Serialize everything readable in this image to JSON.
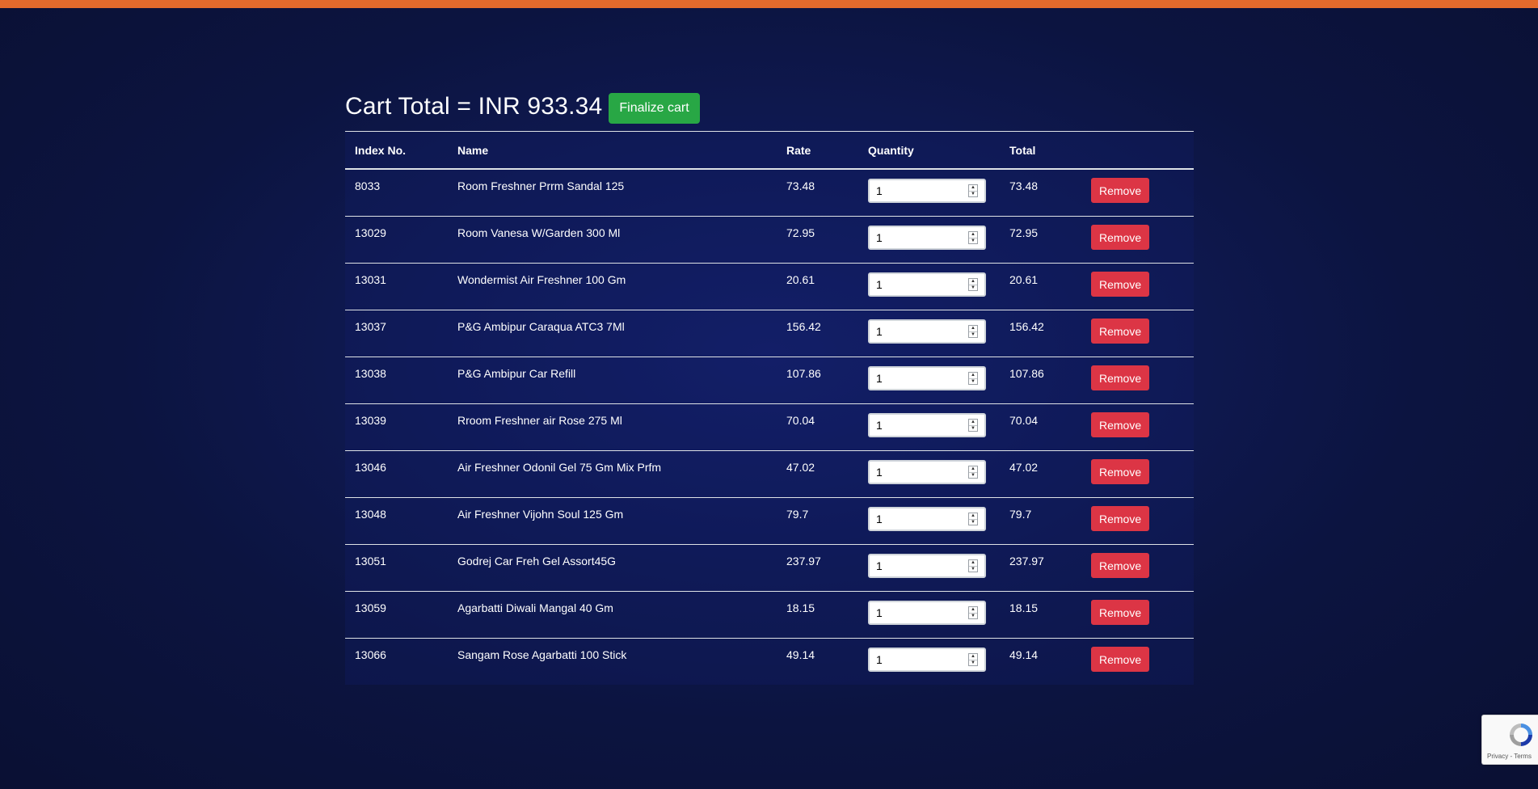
{
  "colors": {
    "top_bar": "#e36a2c",
    "background": "#0c1440",
    "finalize": "#28a745",
    "remove": "#dc3545"
  },
  "cart": {
    "title": "Cart Total = INR 933.34",
    "finalize_label": "Finalize cart"
  },
  "table": {
    "headers": [
      "Index No.",
      "Name",
      "Rate",
      "Quantity",
      "Total",
      ""
    ],
    "remove_label": "Remove",
    "rows": [
      {
        "index": "8033",
        "name": "Room Freshner Prrm Sandal 125",
        "rate": "73.48",
        "qty": "1",
        "total": "73.48"
      },
      {
        "index": "13029",
        "name": "Room Vanesa W/Garden 300 Ml",
        "rate": "72.95",
        "qty": "1",
        "total": "72.95"
      },
      {
        "index": "13031",
        "name": "Wondermist Air Freshner 100 Gm",
        "rate": "20.61",
        "qty": "1",
        "total": "20.61"
      },
      {
        "index": "13037",
        "name": "P&G Ambipur Caraqua ATC3 7Ml",
        "rate": "156.42",
        "qty": "1",
        "total": "156.42"
      },
      {
        "index": "13038",
        "name": "P&G Ambipur Car Refill",
        "rate": "107.86",
        "qty": "1",
        "total": "107.86"
      },
      {
        "index": "13039",
        "name": "Rroom Freshner air Rose 275 Ml",
        "rate": "70.04",
        "qty": "1",
        "total": "70.04"
      },
      {
        "index": "13046",
        "name": "Air Freshner Odonil Gel 75 Gm Mix Prfm",
        "rate": "47.02",
        "qty": "1",
        "total": "47.02"
      },
      {
        "index": "13048",
        "name": "Air Freshner Vijohn Soul 125 Gm",
        "rate": "79.7",
        "qty": "1",
        "total": "79.7"
      },
      {
        "index": "13051",
        "name": "Godrej Car Freh Gel Assort45G",
        "rate": "237.97",
        "qty": "1",
        "total": "237.97"
      },
      {
        "index": "13059",
        "name": "Agarbatti Diwali Mangal 40 Gm",
        "rate": "18.15",
        "qty": "1",
        "total": "18.15"
      },
      {
        "index": "13066",
        "name": "Sangam Rose Agarbatti 100 Stick",
        "rate": "49.14",
        "qty": "1",
        "total": "49.14"
      }
    ]
  },
  "recaptcha": {
    "icon": "recaptcha-icon",
    "links_text": "Privacy - Terms"
  }
}
